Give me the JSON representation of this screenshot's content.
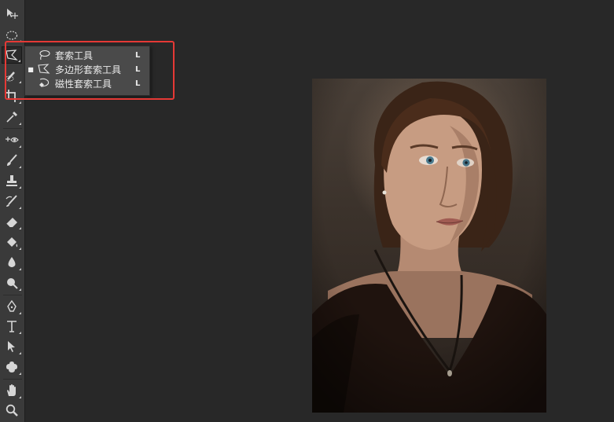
{
  "toolbar": {
    "tools": [
      {
        "name": "move-tool",
        "icon": "move-icon"
      },
      {
        "name": "marquee-tool",
        "icon": "elliptical-marquee-icon"
      },
      {
        "name": "lasso-tool",
        "icon": "polygonal-lasso-icon",
        "active": true
      },
      {
        "name": "quick-selection-tool",
        "icon": "quick-selection-icon"
      },
      {
        "name": "crop-tool",
        "icon": "crop-icon"
      },
      {
        "name": "eyedropper-tool",
        "icon": "eyedropper-icon"
      },
      {
        "name": "spot-healing-tool",
        "icon": "spot-healing-icon"
      },
      {
        "name": "brush-tool",
        "icon": "brush-icon"
      },
      {
        "name": "clone-stamp-tool",
        "icon": "stamp-icon"
      },
      {
        "name": "history-brush-tool",
        "icon": "history-brush-icon"
      },
      {
        "name": "eraser-tool",
        "icon": "eraser-icon"
      },
      {
        "name": "paint-bucket-tool",
        "icon": "paint-bucket-icon"
      },
      {
        "name": "blur-tool",
        "icon": "blur-drop-icon"
      },
      {
        "name": "dodge-tool",
        "icon": "dodge-icon"
      },
      {
        "name": "pen-tool",
        "icon": "pen-icon"
      },
      {
        "name": "type-tool",
        "icon": "type-icon"
      },
      {
        "name": "path-selection-tool",
        "icon": "path-selection-icon"
      },
      {
        "name": "custom-shape-tool",
        "icon": "custom-shape-icon"
      },
      {
        "name": "hand-tool",
        "icon": "hand-icon"
      },
      {
        "name": "zoom-tool",
        "icon": "zoom-icon"
      }
    ]
  },
  "flyout": {
    "items": [
      {
        "label": "套索工具",
        "shortcut": "L",
        "icon": "lasso-icon",
        "selected": false
      },
      {
        "label": "多边形套索工具",
        "shortcut": "L",
        "icon": "polygonal-lasso-icon",
        "selected": true
      },
      {
        "label": "磁性套索工具",
        "shortcut": "L",
        "icon": "magnetic-lasso-icon",
        "selected": false
      }
    ],
    "bullet": "■"
  },
  "colors": {
    "highlight": "#e53935",
    "workspace": "#282828",
    "toolbar": "#3a3a3a"
  }
}
